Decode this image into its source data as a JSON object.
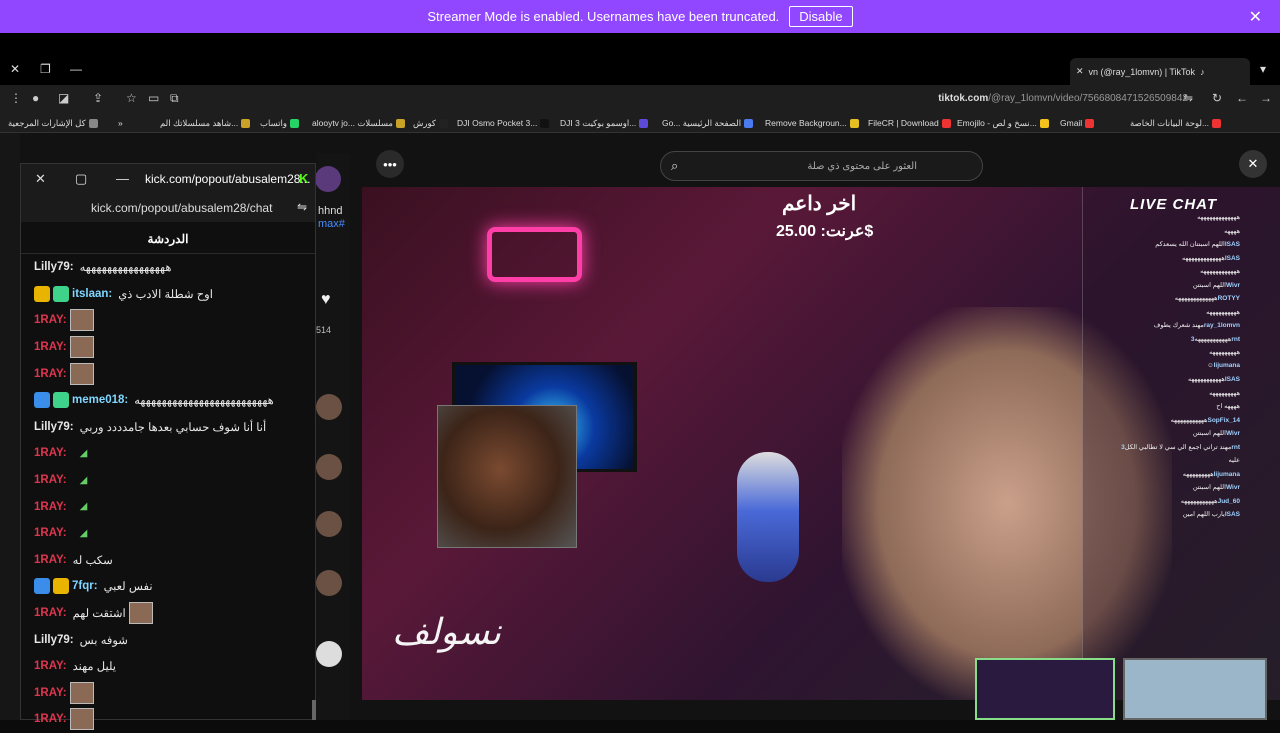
{
  "banner": {
    "message": "Streamer Mode is enabled. Usernames have been truncated.",
    "disable_label": "Disable",
    "close_icon": "close-icon"
  },
  "browser": {
    "tab_title": "vn (@ray_1lomvn) | TikTok",
    "url_domain": "tiktok.com",
    "url_path": "/@ray_1lomvn/video/7566808471526509842",
    "bookmarks": [
      "كل الإشارات المرجعية",
      "شاهد مسلسلاتك الم...",
      "واتساب",
      "alooytv jo... مسلسلات",
      "كورش",
      "DJI Osmo Pocket 3...",
      "DJI اوسمو بوكيت 3...",
      "Go... الصفحة الرئيسية",
      "Remove Backgroun...",
      "FileCR | Download",
      "Emojilo - نسخ و لص...",
      "Gmail",
      "لوحة البيانات الخاصة..."
    ]
  },
  "popup": {
    "title": "kick.com/popout/abusalem28...",
    "url": "kick.com/popout/abusalem28/chat",
    "header": "الدردشة",
    "messages": [
      {
        "user": "Lilly79:",
        "color": "#e8e8e8",
        "text": "ههههههههههههههههه",
        "badges": []
      },
      {
        "user": "itslaan:",
        "color": "#7fd7ff",
        "text": "اوح شطلة الادب ذي",
        "badges": [
          "crown",
          "green"
        ]
      },
      {
        "user": "1RAY:",
        "color": "#e0354e",
        "text": "",
        "badges": [],
        "thumb": true
      },
      {
        "user": "1RAY:",
        "color": "#e0354e",
        "text": "",
        "badges": [],
        "thumb": true
      },
      {
        "user": "1RAY:",
        "color": "#e0354e",
        "text": "",
        "badges": [],
        "thumb": true
      },
      {
        "user": "meme018:",
        "color": "#7fd7ff",
        "text": "هههههههههههههههههههههههههه",
        "badges": [
          "blue",
          "green"
        ]
      },
      {
        "user": "Lilly79:",
        "color": "#e8e8e8",
        "text": "أنا أنا شوف حسابي بعدها جامدددد وربي",
        "badges": []
      },
      {
        "user": "1RAY:",
        "color": "#e0354e",
        "text": "",
        "badges": [],
        "emote": true
      },
      {
        "user": "1RAY:",
        "color": "#e0354e",
        "text": "",
        "badges": [],
        "emote": true
      },
      {
        "user": "1RAY:",
        "color": "#e0354e",
        "text": "",
        "badges": [],
        "emote": true
      },
      {
        "user": "1RAY:",
        "color": "#e0354e",
        "text": "",
        "badges": [],
        "emote": true
      },
      {
        "user": "1RAY:",
        "color": "#e0354e",
        "text": "سكب له",
        "badges": []
      },
      {
        "user": "7fqr:",
        "color": "#7fd7ff",
        "text": "نفس لعبي",
        "badges": [
          "blue",
          "crown"
        ]
      },
      {
        "user": "1RAY:",
        "color": "#e0354e",
        "text": "اشتقت لهم",
        "badges": [],
        "thumb": true
      },
      {
        "user": "Lilly79:",
        "color": "#e8e8e8",
        "text": "شوفه بس",
        "badges": []
      },
      {
        "user": "1RAY:",
        "color": "#e0354e",
        "text": "يليل مهند",
        "badges": []
      },
      {
        "user": "1RAY:",
        "color": "#e0354e",
        "text": "",
        "badges": [],
        "thumb": true
      },
      {
        "user": "1RAY:",
        "color": "#e0354e",
        "text": "",
        "badges": [],
        "thumb": true
      }
    ]
  },
  "side": {
    "name_partial": "hhnd",
    "handle_partial": "max#",
    "likes": "514"
  },
  "search": {
    "placeholder": "العثور على محتوى ذي صلة"
  },
  "video": {
    "title": "اخر داعم",
    "earnings": "عرنت: 25.00$",
    "signature": "نسولف",
    "live_chat_title": "LIVE CHAT",
    "live_rows": [
      {
        "user": "",
        "text": "هههههههههههههه"
      },
      {
        "user": "",
        "text": "ههههه"
      },
      {
        "user": "ISAS",
        "text": "اللهم اسبنتان الله يسعدكم"
      },
      {
        "user": "ISAS",
        "text": "هههههههههههههه"
      },
      {
        "user": "",
        "text": "ههههههههههههه"
      },
      {
        "user": "Wivr",
        "text": "اللهم اسبنتن"
      },
      {
        "user": "ROTYY",
        "text": "هههههههههههههه"
      },
      {
        "user": "",
        "text": "ههههههههههه"
      },
      {
        "user": "ray_1lomvn",
        "text": "مهند شعرك يطوف"
      },
      {
        "user": "3rnt",
        "text": "هههههههههههه"
      },
      {
        "user": "",
        "text": "هههههههههه"
      },
      {
        "user": "lijumana",
        "text": "☺"
      },
      {
        "user": "ISAS",
        "text": "هههههههههههه"
      },
      {
        "user": "",
        "text": "هههههههههه"
      },
      {
        "user": "",
        "text": "ههههه اح"
      },
      {
        "user": "SopFix_14",
        "text": "هههههههههههه"
      },
      {
        "user": "Wivr",
        "text": "اللهم اسبنتن"
      },
      {
        "user": "3rnt",
        "text": "مهند تراني اجمع الي سي لا تطالبي الكل"
      },
      {
        "user": "",
        "text": "عليه"
      },
      {
        "user": "lijumana",
        "text": "هههههههههه"
      },
      {
        "user": "Wivr",
        "text": "اللهم اسبنتن"
      },
      {
        "user": "Jud_60",
        "text": "هههههههههههه"
      },
      {
        "user": "ISAS",
        "text": "يارب اللهم امين"
      }
    ]
  }
}
